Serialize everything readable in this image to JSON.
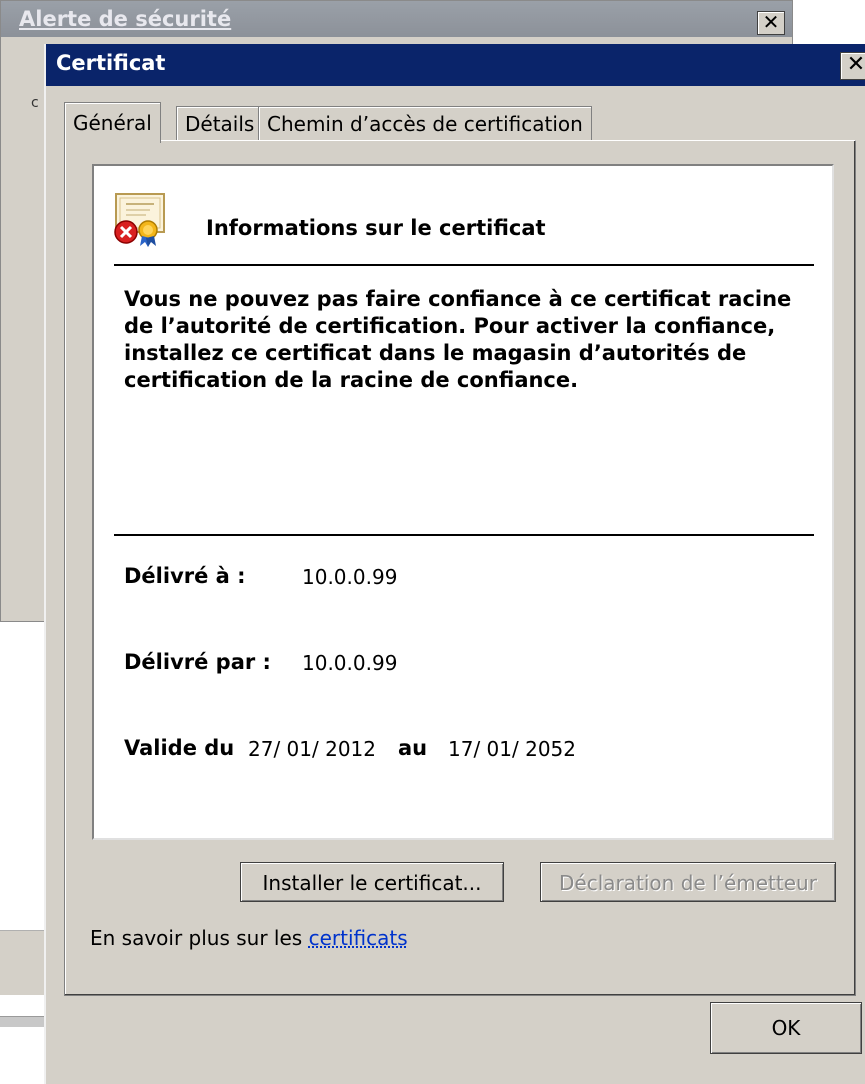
{
  "background_window": {
    "title": "Alerte de sécurité",
    "close_glyph": "✕",
    "stray_text": "c"
  },
  "dialog": {
    "title": "Certificat",
    "close_glyph": "✕"
  },
  "tabs": [
    {
      "label": "Général",
      "active": true
    },
    {
      "label": "Détails",
      "active": false
    },
    {
      "label": "Chemin d’accès de certification",
      "active": false
    }
  ],
  "info": {
    "icon": "certificate-error-icon",
    "heading": "Informations sur le certificat",
    "warning": "Vous ne pouvez pas faire confiance à ce certificat racine de l’autorité de certification. Pour activer la confiance, installez ce certificat dans le magasin d’autorités de certification de la racine de confiance."
  },
  "details": {
    "issued_to_label": "Délivré à :",
    "issued_to_value": "10.0.0.99",
    "issued_by_label": "Délivré par :",
    "issued_by_value": "10.0.0.99",
    "valid_from_label": "Valide du",
    "valid_from_value": "27/ 01/ 2012",
    "valid_to_label": "au",
    "valid_to_value": "17/ 01/ 2052"
  },
  "buttons": {
    "install": "Installer le certificat...",
    "issuer_statement": "Déclaration de l’émetteur",
    "ok": "OK"
  },
  "learn_more": {
    "prefix": "En savoir plus sur les ",
    "link": "certificats"
  },
  "colors": {
    "titlebar_active": "#0a246a",
    "titlebar_inactive": "#8c9199",
    "dialog_face": "#d4d0c8",
    "link": "#0033cc"
  }
}
